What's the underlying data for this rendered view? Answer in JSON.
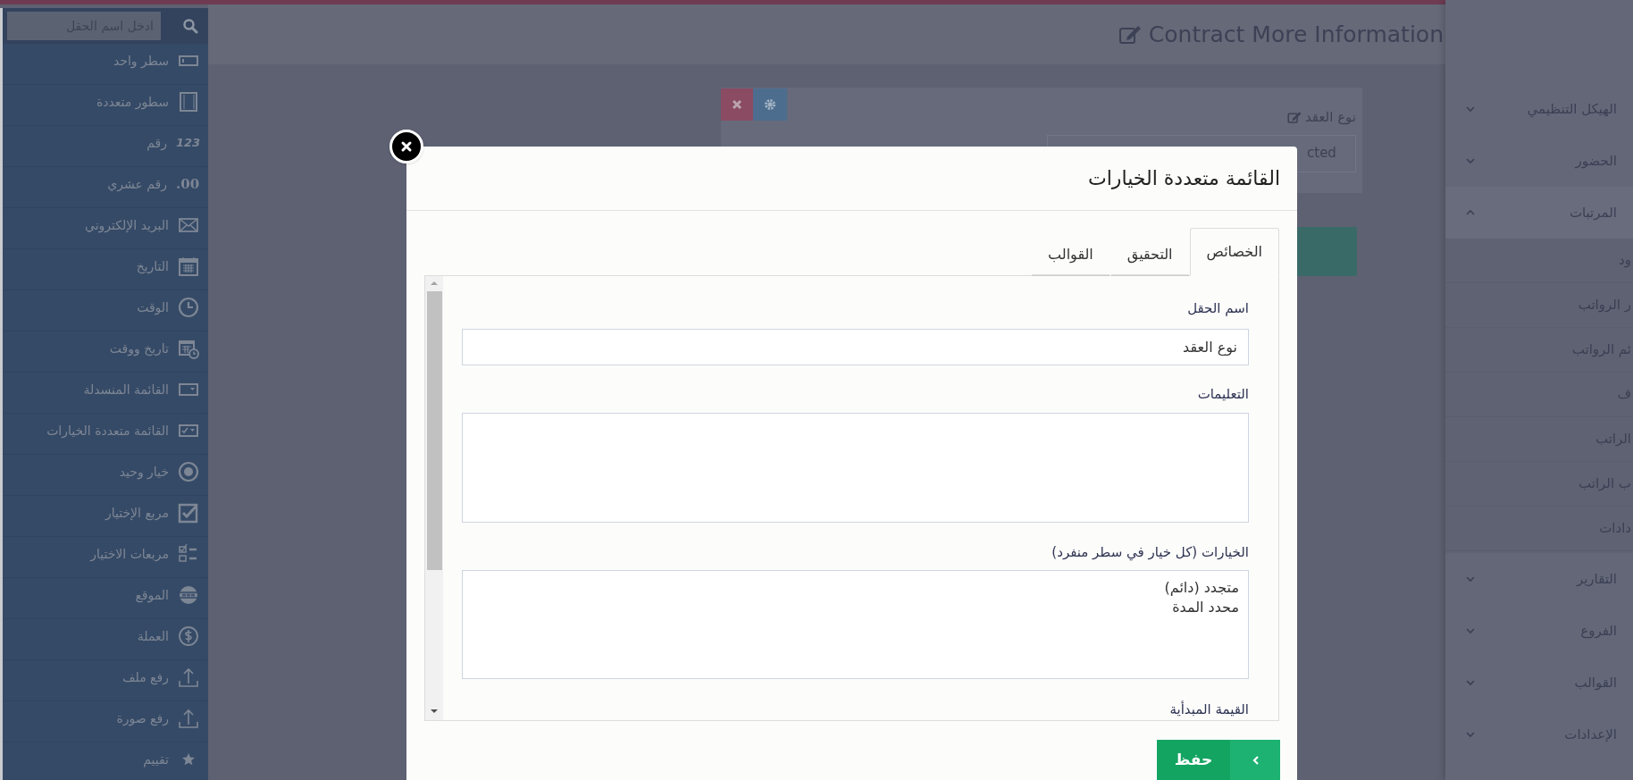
{
  "left_sidebar": {
    "search": {
      "placeholder": "ادخل اسم الحقل"
    },
    "items": [
      {
        "label": "سطر واحد",
        "kind": "single-line"
      },
      {
        "label": "سطور متعددة",
        "kind": "multi-line"
      },
      {
        "label": "رقم",
        "kind": "number",
        "icon_text": "123"
      },
      {
        "label": "رقم عشري",
        "kind": "decimal",
        "icon_text": ".00"
      },
      {
        "label": "البريد الإلكتروني",
        "kind": "email"
      },
      {
        "label": "التاريخ",
        "kind": "date"
      },
      {
        "label": "الوقت",
        "kind": "time"
      },
      {
        "label": "تاريخ ووقت",
        "kind": "datetime"
      },
      {
        "label": "القائمة المنسدلة",
        "kind": "dropdown"
      },
      {
        "label": "القائمة متعددة الخيارات",
        "kind": "multiselect"
      },
      {
        "label": "خيار وحيد",
        "kind": "radio"
      },
      {
        "label": "مربع الإختيار",
        "kind": "checkbox"
      },
      {
        "label": "مربعات الاختيار",
        "kind": "checkboxes"
      },
      {
        "label": "الموقع",
        "kind": "website"
      },
      {
        "label": "العملة",
        "kind": "currency"
      },
      {
        "label": "رفع ملف",
        "kind": "upload"
      },
      {
        "label": "رفع صورة",
        "kind": "upload"
      },
      {
        "label": "تقييم",
        "kind": "rating"
      }
    ]
  },
  "main": {
    "title": "Contract More Information",
    "field_card": {
      "label": "نوع العقد",
      "value": "cted"
    }
  },
  "right_sidebar": {
    "items": [
      {
        "label": "الهيكل التنظيمي",
        "expanded": false
      },
      {
        "label": "الحضور",
        "expanded": false
      },
      {
        "label": "المرتبات",
        "expanded": true,
        "children": [
          {
            "label": "ود"
          },
          {
            "label": "ر الرواتب"
          },
          {
            "label": "ئم الرواتب"
          },
          {
            "label": "ف"
          },
          {
            "label": "الراتب"
          },
          {
            "label": "ب الراتب"
          },
          {
            "label": "دادات"
          }
        ]
      },
      {
        "label": "التقارير",
        "expanded": false
      },
      {
        "label": "الفروع",
        "expanded": false
      },
      {
        "label": "القوالب",
        "expanded": false
      },
      {
        "label": "الإعدادات",
        "expanded": false
      }
    ]
  },
  "modal": {
    "title": "القائمة متعددة الخيارات",
    "tabs": [
      {
        "label": "الخصائص",
        "selected": true
      },
      {
        "label": "التحقيق",
        "selected": false
      },
      {
        "label": "القوالب",
        "selected": false
      }
    ],
    "fields": [
      {
        "label": "اسم الحقل",
        "kind": "input",
        "value": "نوع العقد"
      },
      {
        "label": "التعليمات",
        "kind": "textarea"
      },
      {
        "label": "الخيارات (كل خيار في سطر منفرد)",
        "kind": "textarea",
        "lines": [
          "متجدد (دائم)",
          "محدد المدة"
        ]
      },
      {
        "label": "القيمة المبدأية"
      }
    ],
    "save_button": {
      "label": "حفظ"
    }
  }
}
